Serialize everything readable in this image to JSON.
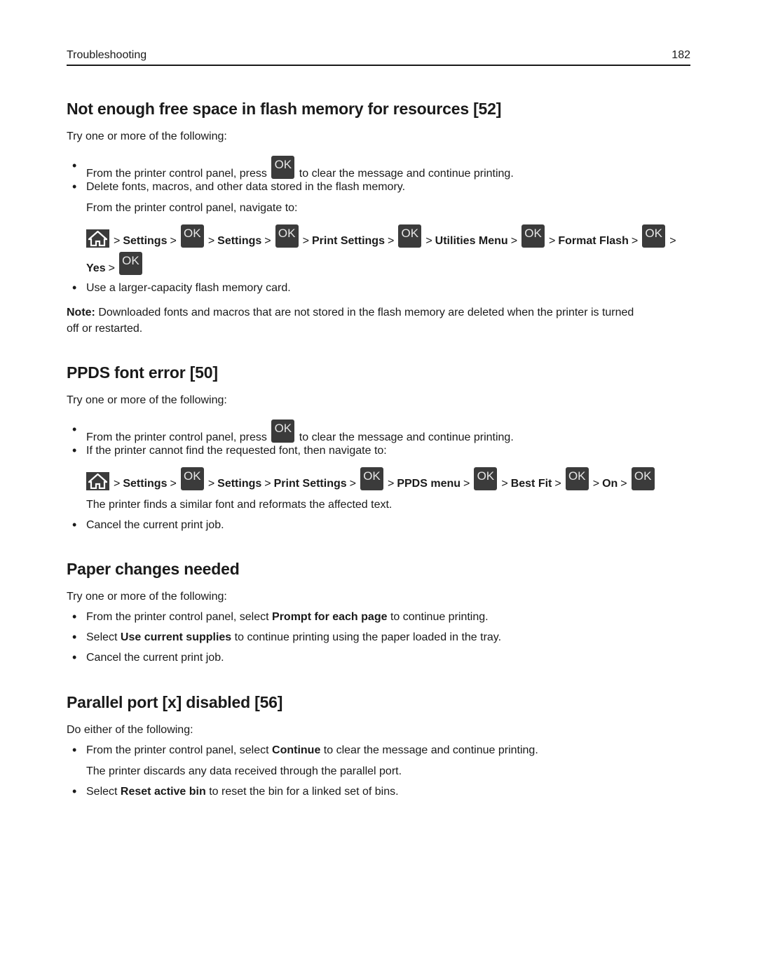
{
  "header": {
    "section": "Troubleshooting",
    "page_number": "182"
  },
  "colors": {
    "ok_button_bg": "#3b3b3b",
    "ok_button_text": "#e6e6e6",
    "text": "#1a1a1a"
  },
  "icons": {
    "home": "home-icon",
    "ok": "ok-button-icon"
  },
  "ok_label": "OK",
  "sections": [
    {
      "title": "Not enough free space in flash memory for resources [52]",
      "intro": "Try one or more of the following:",
      "bullets": [
        {
          "before": "From the printer control panel, press",
          "after": "to clear the message and continue printing."
        },
        {
          "text": "Delete fonts, macros, and other data stored in the flash memory.",
          "sub": "From the printer control panel, navigate to:"
        },
        {
          "text": "Use a larger-capacity flash memory card."
        }
      ],
      "path": [
        "Settings",
        "Settings",
        "Print Settings",
        "Utilities Menu",
        "Format Flash",
        "Yes"
      ],
      "note_label": "Note:",
      "note_line1": "Downloaded fonts and macros that are not stored in the flash memory are deleted when the printer is turned",
      "note_line2": "off or restarted."
    },
    {
      "title": "PPDS font error [50]",
      "intro": "Try one or more of the following:",
      "bullets": [
        {
          "before": "From the printer control panel, press",
          "after": "to clear the message and continue printing."
        },
        {
          "text": "If the printer cannot find the requested font, then navigate to:",
          "sub": "The printer finds a similar font and reformats the affected text."
        },
        {
          "text": "Cancel the current print job."
        }
      ],
      "path": [
        "Settings",
        "Settings",
        "Print Settings",
        "PPDS menu",
        "Best Fit",
        "On"
      ]
    },
    {
      "title": "Paper changes needed",
      "intro": "Try one or more of the following:",
      "bullets": [
        {
          "before": "From the printer control panel, select",
          "bold": "Prompt for each page",
          "after": "to continue printing."
        },
        {
          "before": "Select",
          "bold": "Use current supplies",
          "after": "to continue printing using the paper loaded in the tray."
        },
        {
          "text": "Cancel the current print job."
        }
      ]
    },
    {
      "title": "Parallel port [x] disabled [56]",
      "intro": "Do either of the following:",
      "bullets": [
        {
          "before": "From the printer control panel, select",
          "bold": "Continue",
          "after": "to clear the message and continue printing.",
          "sub": "The printer discards any data received through the parallel port."
        },
        {
          "before": "Select",
          "bold": "Reset active bin",
          "after": "to reset the bin for a linked set of bins."
        }
      ]
    }
  ]
}
